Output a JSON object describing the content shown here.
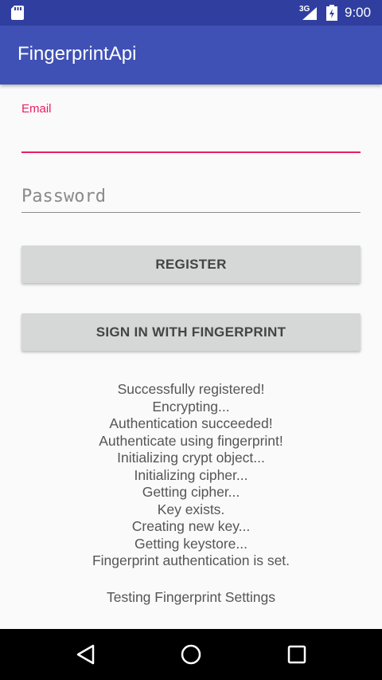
{
  "status_bar": {
    "network_type": "3G",
    "time": "9:00",
    "icons": [
      "sd-card-icon",
      "signal-icon",
      "battery-icon"
    ]
  },
  "app_bar": {
    "title": "FingerprintApi"
  },
  "form": {
    "email_label": "Email",
    "email_value": "",
    "password_placeholder": "Password",
    "password_value": ""
  },
  "buttons": {
    "register_label": "REGISTER",
    "fingerprint_label": "SIGN IN WITH FINGERPRINT"
  },
  "log": {
    "lines": [
      "Successfully registered!",
      "Encrypting...",
      "Authentication succeeded!",
      "Authenticate using fingerprint!",
      "Initializing crypt object...",
      "Initializing cipher...",
      "Getting cipher...",
      "Key exists.",
      "Creating new key...",
      "Getting keystore...",
      "Fingerprint authentication is set."
    ],
    "footer": "Testing Fingerprint Settings"
  },
  "nav_bar": {
    "icons": [
      "back-icon",
      "home-icon",
      "recents-icon"
    ]
  },
  "colors": {
    "status_bar": "#303f9f",
    "app_bar": "#3f51b5",
    "accent": "#e91e63",
    "button": "#d6d7d7"
  }
}
